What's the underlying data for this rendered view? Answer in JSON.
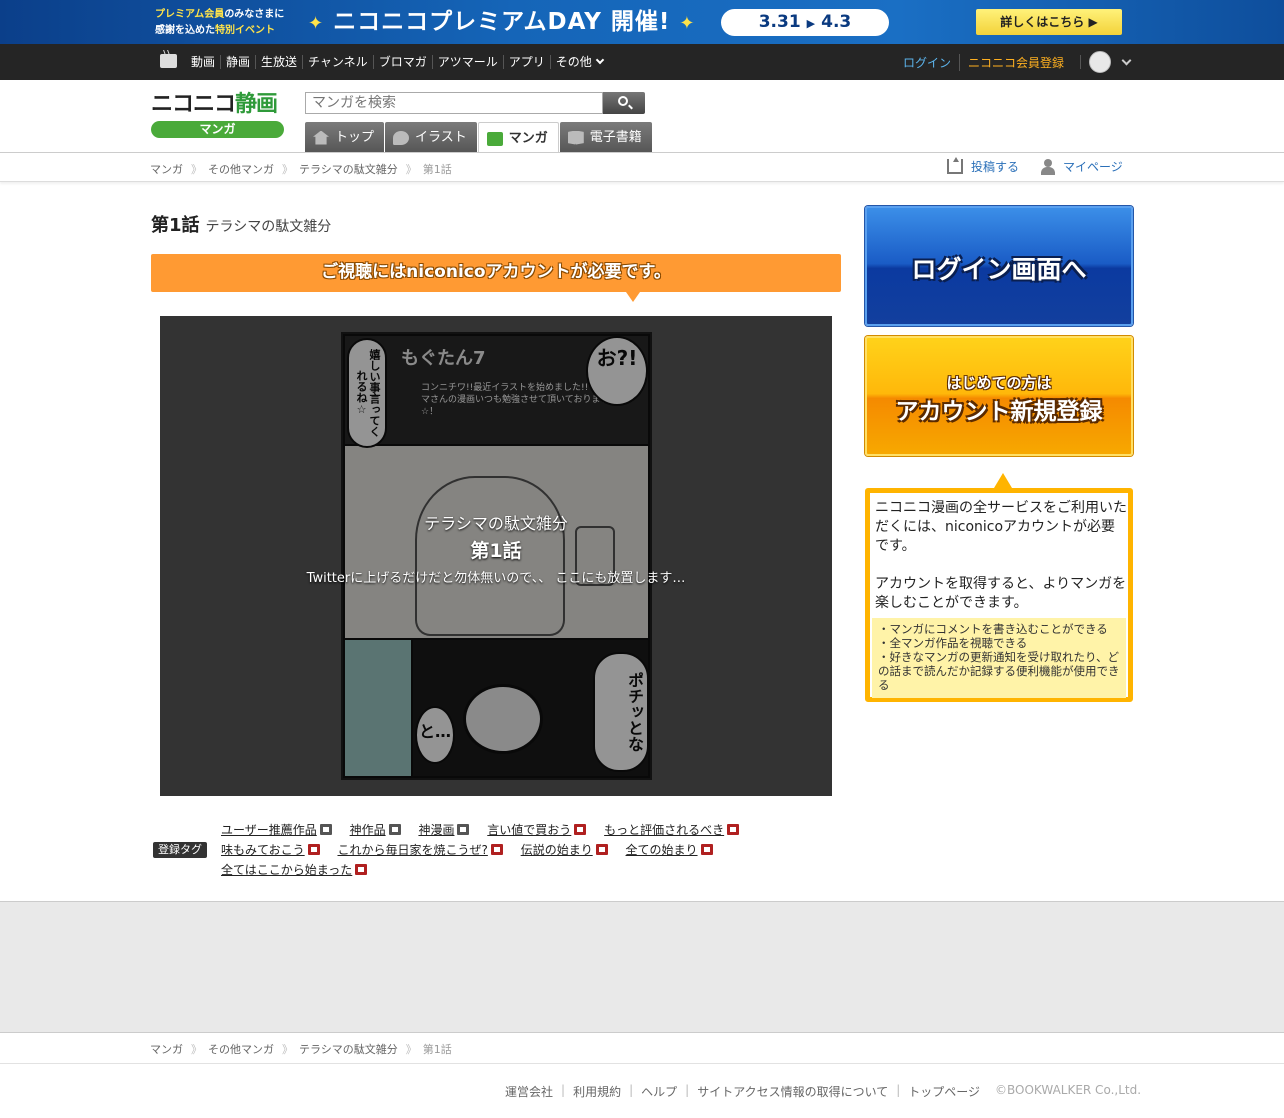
{
  "premium_banner": {
    "line1_a": "プレミアム会員",
    "line1_b": "のみなさまに",
    "line2_a": "感謝を込めた",
    "line2_b": "特別イベント",
    "title": "ニコニコプレミアムDAY 開催!",
    "date_start": "3.31",
    "date_end": "4.3",
    "button": "詳しくはこちら ▶"
  },
  "global_nav": {
    "items": [
      "動画",
      "静画",
      "生放送",
      "チャンネル",
      "ブロマガ",
      "アツマール",
      "アプリ",
      "その他"
    ],
    "login": "ログイン",
    "register": "ニコニコ会員登録"
  },
  "header": {
    "logo_text": "ニコニコ",
    "logo_accent": "静画",
    "logo_sub": "マンガ",
    "search_placeholder": "マンガを検索",
    "tabs": [
      {
        "label": "トップ",
        "icon": "home-icon"
      },
      {
        "label": "イラスト",
        "icon": "illust-icon"
      },
      {
        "label": "マンガ",
        "icon": "manga-icon"
      },
      {
        "label": "電子書籍",
        "icon": "book-icon"
      }
    ],
    "post_label": "投稿する",
    "mypage_label": "マイページ"
  },
  "breadcrumb": [
    "マンガ",
    "その他マンガ",
    "テラシマの駄文雑分",
    "第1話"
  ],
  "episode": {
    "number": "第1話",
    "series": "テラシマの駄文雑分",
    "need_account": "ご視聴にはniconicoアカウントが必要です。",
    "description": "Twitterに上げるだけだと勿体無いので、、 ここにも放置します…"
  },
  "manga_page_text": {
    "header": "もぐたん7",
    "msg": "コンニチワ!!最近イラストを始めました!! テラシマさんの漫画いつも勉強させて頂いております☆！",
    "bubble1": "お?!",
    "bubble2": "嬉しい事言ってくれるね☆",
    "bubble3": "ポチッとな",
    "bubble4": "と…"
  },
  "tags": {
    "badge": "登録タグ",
    "items": [
      "ユーザー推薦作品",
      "神作品",
      "神漫画",
      "言い値で買おう",
      "もっと評価されるべき",
      "味もみておこう",
      "これから毎日家を焼こうぜ?",
      "伝説の始まり",
      "全ての始まり",
      "全てはここから始まった"
    ]
  },
  "sidebar": {
    "login_button": "ログイン画面へ",
    "signup_line1": "はじめての方は",
    "signup_line2": "アカウント新規登録",
    "info_p1": "ニコニコ漫画の全サービスをご利用いただくには、niconicoアカウントが必要です。",
    "info_p2": "アカウントを取得すると、よりマンガを楽しむことができます。",
    "benefits": [
      "・マンガにコメントを書き込むことができる",
      "・全マンガ作品を視聴できる",
      "・好きなマンガの更新通知を受け取れたり、どの話まで読んだか記録する便利機能が使用できる"
    ]
  },
  "footer": {
    "links": [
      "運営会社",
      "利用規約",
      "ヘルプ",
      "サイトアクセス情報の取得について",
      "トップページ"
    ],
    "copyright": "©BOOKWALKER Co.,Ltd."
  },
  "colors": {
    "nav_bg": "#252525",
    "login_blue": "#1a5cc6",
    "signup_orange": "#ffb400",
    "need_bar": "#ff9a33",
    "link_blue": "#2a6fb8"
  }
}
